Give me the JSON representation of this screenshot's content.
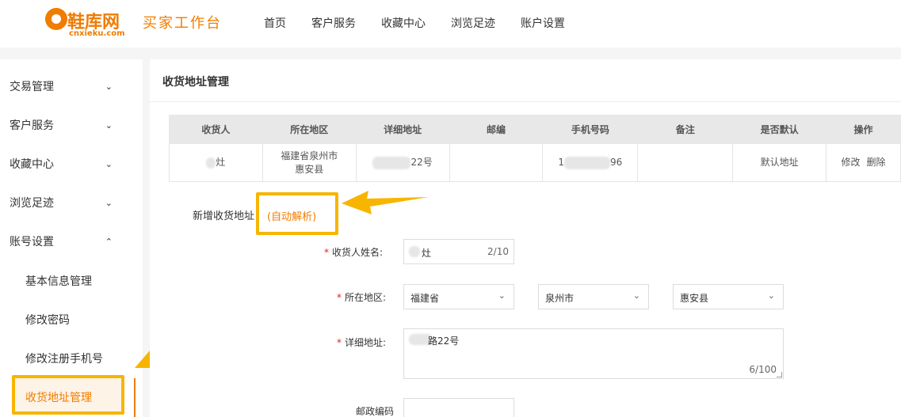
{
  "header": {
    "logo_text": "鞋库网",
    "logo_sub": "cnxieku.com",
    "workspace": "买家工作台",
    "nav": [
      "首页",
      "客户服务",
      "收藏中心",
      "浏览足迹",
      "账户设置"
    ]
  },
  "sidebar": {
    "groups": [
      {
        "label": "交易管理",
        "icon": "chevron-down-icon"
      },
      {
        "label": "客户服务",
        "icon": "chevron-down-icon"
      },
      {
        "label": "收藏中心",
        "icon": "chevron-down-icon"
      },
      {
        "label": "浏览足迹",
        "icon": "chevron-down-icon"
      },
      {
        "label": "账号设置",
        "icon": "chevron-up-icon"
      }
    ],
    "sub_items": [
      "基本信息管理",
      "修改密码",
      "修改注册手机号",
      "收货地址管理"
    ]
  },
  "main": {
    "title": "收货地址管理",
    "table": {
      "headers": [
        "收货人",
        "所在地区",
        "详细地址",
        "邮编",
        "手机号码",
        "备注",
        "是否默认",
        "操作"
      ],
      "rows": [
        {
          "name": "灶",
          "region_line1": "福建省泉州市",
          "region_line2": "惠安县",
          "detail": "22号",
          "zip": "",
          "phone_prefix": "1",
          "phone_suffix": "96",
          "note": "",
          "default": "默认地址",
          "edit": "修改",
          "delete": "删除"
        }
      ]
    },
    "add_label": "新增收货地址",
    "auto_parse": "(自动解析)",
    "form": {
      "name_label": "收货人姓名:",
      "name_value": "灶",
      "name_count": "2/10",
      "region_label": "所在地区:",
      "province": "福建省",
      "city": "泉州市",
      "county": "惠安县",
      "detail_label": "详细地址:",
      "detail_value": "路22号",
      "detail_count": "6/100",
      "zip_label": "邮政编码"
    }
  },
  "colors": {
    "accent": "#f07c00",
    "highlight": "#f7b500",
    "required": "#e02020"
  }
}
